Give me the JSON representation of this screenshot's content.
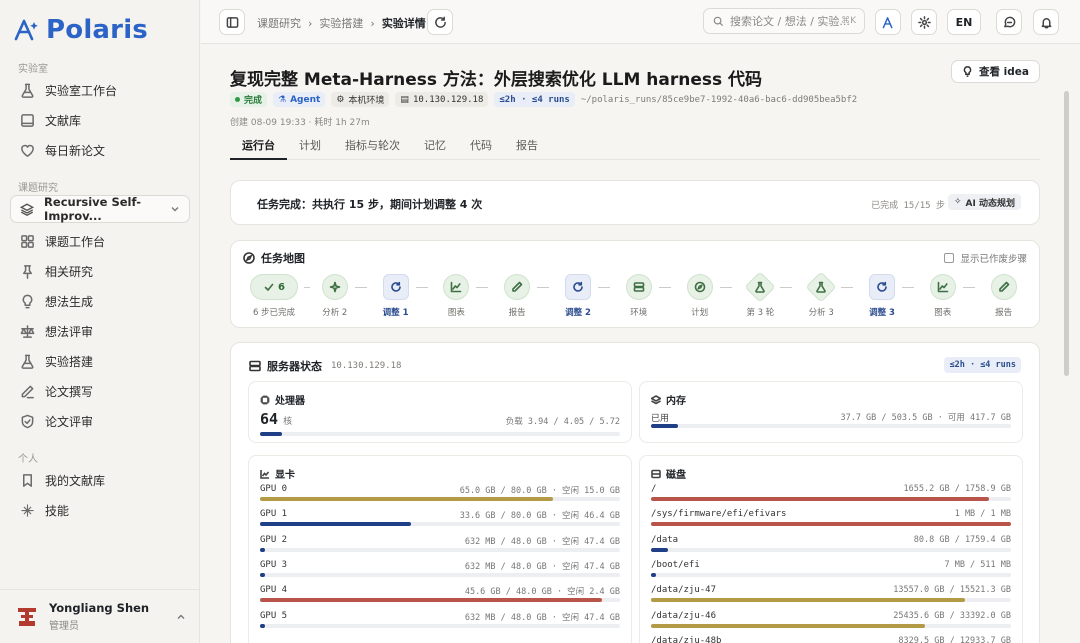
{
  "app": {
    "brand": "Polaris"
  },
  "sidebar": {
    "sections": [
      {
        "label": "实验室",
        "items": [
          {
            "label": "实验室工作台",
            "icon": "flask-icon"
          },
          {
            "label": "文献库",
            "icon": "book-icon"
          },
          {
            "label": "每日新论文",
            "icon": "heart-icon"
          }
        ]
      },
      {
        "label": "课题研究",
        "topic": "Recursive Self-Improv...",
        "items": [
          {
            "label": "课题工作台",
            "icon": "grid-icon"
          },
          {
            "label": "相关研究",
            "icon": "pin-icon"
          },
          {
            "label": "想法生成",
            "icon": "bulb-icon"
          },
          {
            "label": "想法评审",
            "icon": "scale-icon"
          },
          {
            "label": "实验搭建",
            "icon": "flask-icon"
          },
          {
            "label": "论文撰写",
            "icon": "pen-icon"
          },
          {
            "label": "论文评审",
            "icon": "shield-icon"
          }
        ]
      },
      {
        "label": "个人",
        "items": [
          {
            "label": "我的文献库",
            "icon": "bookmark-icon"
          },
          {
            "label": "技能",
            "icon": "sparkle-icon"
          }
        ]
      }
    ],
    "user": {
      "name": "Yongliang Shen",
      "role": "管理员"
    }
  },
  "topbar": {
    "breadcrumbs": [
      "课题研究",
      "实验搭建",
      "实验详情"
    ],
    "search_placeholder": "搜索论文 / 想法 / 实验...",
    "search_shortcut": "⌘K",
    "lang": "EN"
  },
  "page": {
    "title": "复现完整 Meta-Harness 方法：外层搜索优化 LLM harness 代码",
    "idea_button": "查看 idea",
    "chips": {
      "status": "完成",
      "agent": "Agent",
      "env": "本机环境",
      "ip": "10.130.129.18",
      "budget": "≤2h · ≤4 runs",
      "path": "~/polaris_runs/85ce9be7-1992-40a6-bac6-dd905bea5bf2"
    },
    "meta": "创建 08-09 19:33 · 耗时 1h 27m",
    "tabs": [
      "运行台",
      "计划",
      "指标与轮次",
      "记忆",
      "代码",
      "报告"
    ],
    "active_tab": 0
  },
  "summary": {
    "text": "任务完成：共执行 15 步，期间计划调整 4 次",
    "progress": "已完成 15/15 步",
    "ai_badge": "AI 动态规划"
  },
  "task_map": {
    "title": "任务地图",
    "show_done": "显示已作废步骤",
    "first_count": "6",
    "steps": [
      {
        "label": "6 步已完成",
        "kind": "first",
        "icon": "check-icon"
      },
      {
        "label": "分析 2",
        "kind": "normal",
        "icon": "sparkle-icon"
      },
      {
        "label": "调整 1",
        "kind": "adjust",
        "icon": "refresh-icon"
      },
      {
        "label": "图表",
        "kind": "normal",
        "icon": "chart-icon"
      },
      {
        "label": "报告",
        "kind": "normal",
        "icon": "pen-icon"
      },
      {
        "label": "调整 2",
        "kind": "adjust",
        "icon": "refresh-icon"
      },
      {
        "label": "环境",
        "kind": "normal",
        "icon": "server-icon"
      },
      {
        "label": "计划",
        "kind": "normal",
        "icon": "compass-icon"
      },
      {
        "label": "第 3 轮",
        "kind": "round",
        "icon": "flask-icon"
      },
      {
        "label": "分析 3",
        "kind": "round",
        "icon": "flask-icon"
      },
      {
        "label": "调整 3",
        "kind": "adjust",
        "icon": "refresh-icon"
      },
      {
        "label": "图表",
        "kind": "normal",
        "icon": "chart-icon"
      },
      {
        "label": "报告",
        "kind": "normal",
        "icon": "pen-icon"
      }
    ]
  },
  "server": {
    "title": "服务器状态",
    "ip": "10.130.129.18",
    "budget": "≤2h · ≤4 runs",
    "cpu": {
      "title": "处理器",
      "cores": "64",
      "unit": "核",
      "load": "负载 3.94 / 4.05 / 5.72",
      "fraction": 0.06
    },
    "memory": {
      "title": "内存",
      "label": "已用",
      "value": "37.7 GB / 503.5 GB · 可用 417.7 GB",
      "fraction": 0.075
    },
    "gpu": {
      "title": "显卡",
      "items": [
        {
          "name": "GPU 0",
          "value": "65.0 GB / 80.0 GB · 空闲 15.0 GB",
          "fraction": 0.8125,
          "color": "#b39b45"
        },
        {
          "name": "GPU 1",
          "value": "33.6 GB / 80.0 GB · 空闲 46.4 GB",
          "fraction": 0.42,
          "color": "#1f3f86"
        },
        {
          "name": "GPU 2",
          "value": "632 MB / 48.0 GB · 空闲 47.4 GB",
          "fraction": 0.013,
          "color": "#1f3f86"
        },
        {
          "name": "GPU 3",
          "value": "632 MB / 48.0 GB · 空闲 47.4 GB",
          "fraction": 0.013,
          "color": "#1f3f86"
        },
        {
          "name": "GPU 4",
          "value": "45.6 GB / 48.0 GB · 空闲 2.4 GB",
          "fraction": 0.95,
          "color": "#b8544a"
        },
        {
          "name": "GPU 5",
          "value": "632 MB / 48.0 GB · 空闲 47.4 GB",
          "fraction": 0.013,
          "color": "#1f3f86"
        }
      ]
    },
    "disk": {
      "title": "磁盘",
      "items": [
        {
          "name": "/",
          "value": "1655.2 GB / 1758.9 GB",
          "fraction": 0.94,
          "color": "#b8544a"
        },
        {
          "name": "/sys/firmware/efi/efivars",
          "value": "1 MB / 1 MB",
          "fraction": 1.0,
          "color": "#b8544a"
        },
        {
          "name": "/data",
          "value": "80.8 GB / 1759.4 GB",
          "fraction": 0.046,
          "color": "#1f3f86"
        },
        {
          "name": "/boot/efi",
          "value": "7 MB / 511 MB",
          "fraction": 0.014,
          "color": "#1f3f86"
        },
        {
          "name": "/data/zju-47",
          "value": "13557.0 GB / 15521.3 GB",
          "fraction": 0.873,
          "color": "#b39b45"
        },
        {
          "name": "/data/zju-46",
          "value": "25435.6 GB / 33392.0 GB",
          "fraction": 0.762,
          "color": "#b39b45"
        },
        {
          "name": "/data/zju-48b",
          "value": "8329.5 GB / 12933.7 GB",
          "fraction": 0.644,
          "color": "#1f3f86"
        }
      ]
    }
  }
}
